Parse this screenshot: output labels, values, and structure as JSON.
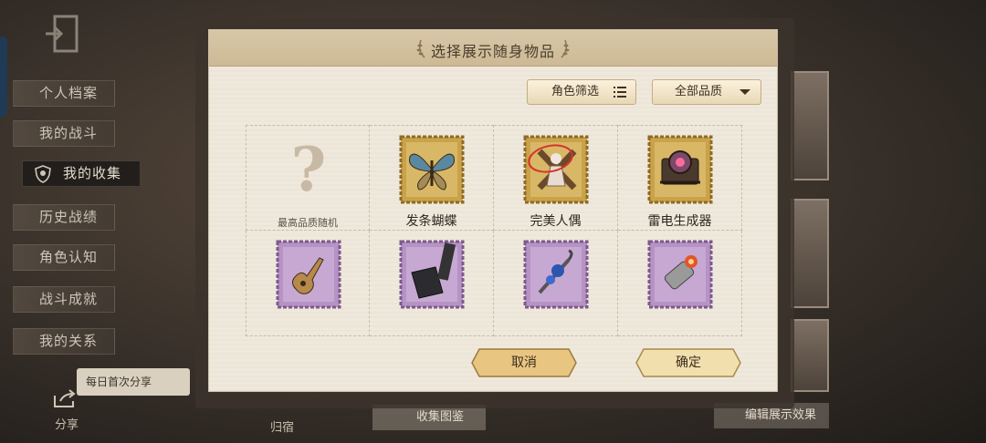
{
  "modal": {
    "title": "选择展示随身物品",
    "role_filter_label": "角色筛选",
    "quality_filter_label": "全部品质",
    "items": [
      {
        "label": "最高品质随机",
        "kind": "random"
      },
      {
        "label": "发条蝴蝶",
        "kind": "gold-butterfly"
      },
      {
        "label": "完美人偶",
        "kind": "gold-doll"
      },
      {
        "label": "雷电生成器",
        "kind": "gold-generator"
      },
      {
        "label": "",
        "kind": "purple-guitar"
      },
      {
        "label": "",
        "kind": "purple-phone"
      },
      {
        "label": "",
        "kind": "purple-umbrella"
      },
      {
        "label": "",
        "kind": "purple-lighter"
      }
    ],
    "cancel_label": "取消",
    "confirm_label": "确定"
  },
  "sidebar": {
    "items": [
      {
        "label": "个人档案"
      },
      {
        "label": "我的战斗"
      },
      {
        "label": "我的收集"
      },
      {
        "label": "历史战绩"
      },
      {
        "label": "角色认知"
      },
      {
        "label": "战斗成就"
      },
      {
        "label": "我的关系"
      }
    ],
    "active_index": 2
  },
  "footer": {
    "share_badge": "每日首次分享",
    "share_label": "分享",
    "archive_label": "归宿",
    "gallery_label": "收集图鉴",
    "edit_label": "编辑展示效果"
  },
  "colors": {
    "gold_stamp": "#c9a24a",
    "purple_stamp": "#b693c4",
    "parchment": "#efe9dd",
    "header": "#d1bd98"
  }
}
